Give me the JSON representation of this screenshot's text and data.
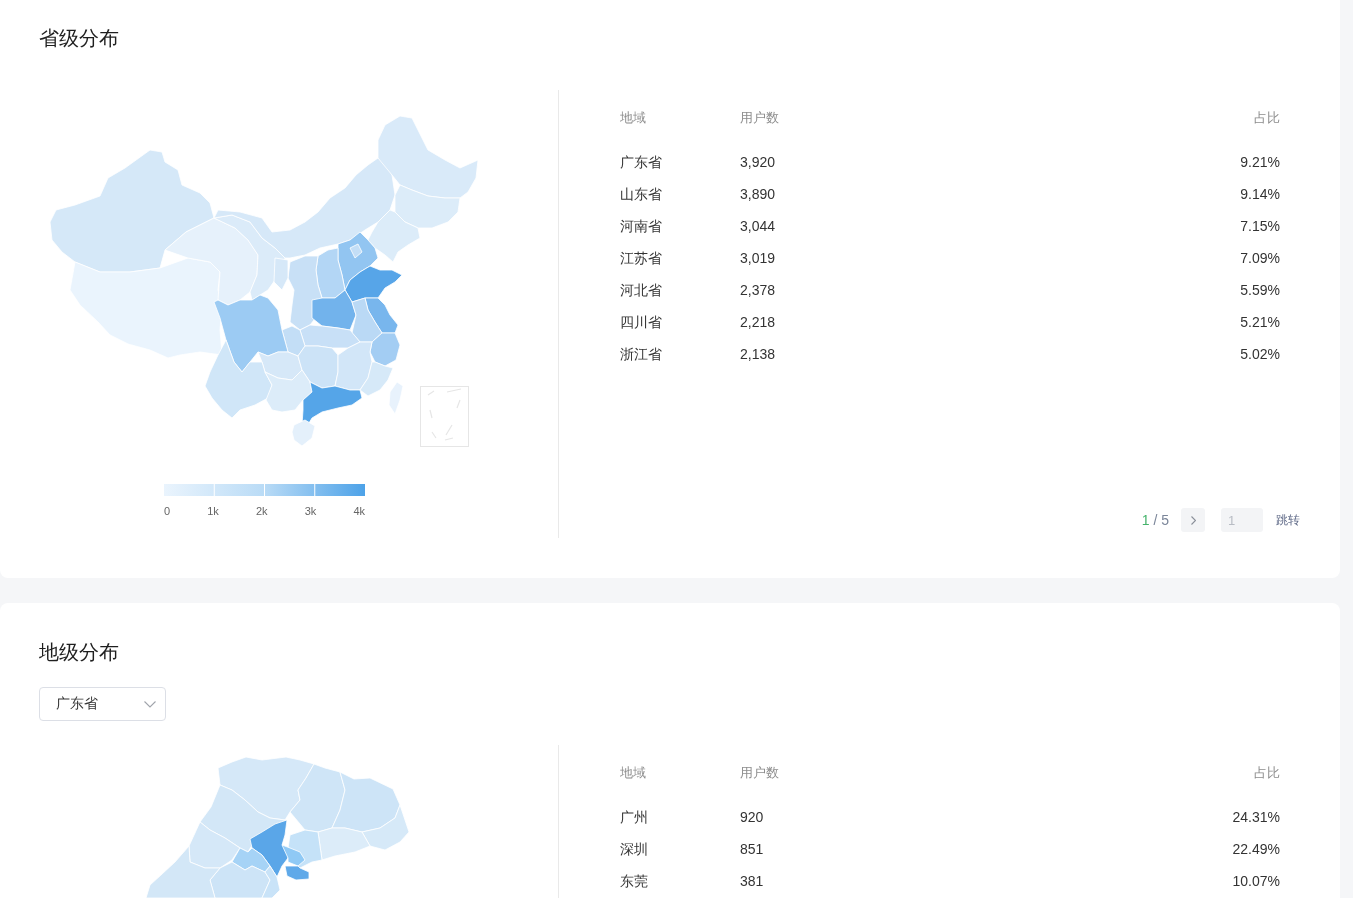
{
  "province_distribution": {
    "title": "省级分布",
    "legend": {
      "labels": [
        "0",
        "1k",
        "2k",
        "3k",
        "4k"
      ]
    },
    "table": {
      "columns": [
        "地域",
        "用户数",
        "占比"
      ],
      "rows": [
        {
          "region": "广东省",
          "users": "3,920",
          "share": "9.21%"
        },
        {
          "region": "山东省",
          "users": "3,890",
          "share": "9.14%"
        },
        {
          "region": "河南省",
          "users": "3,044",
          "share": "7.15%"
        },
        {
          "region": "江苏省",
          "users": "3,019",
          "share": "7.09%"
        },
        {
          "region": "河北省",
          "users": "2,378",
          "share": "5.59%"
        },
        {
          "region": "四川省",
          "users": "2,218",
          "share": "5.21%"
        },
        {
          "region": "浙江省",
          "users": "2,138",
          "share": "5.02%"
        }
      ]
    },
    "pagination": {
      "current": "1",
      "total": "/ 5",
      "jump_placeholder": "1",
      "jump_label": "跳转"
    }
  },
  "city_distribution": {
    "title": "地级分布",
    "select": {
      "value": "广东省"
    },
    "table": {
      "columns": [
        "地域",
        "用户数",
        "占比"
      ],
      "rows": [
        {
          "region": "广州",
          "users": "920",
          "share": "24.31%"
        },
        {
          "region": "深圳",
          "users": "851",
          "share": "22.49%"
        },
        {
          "region": "东莞",
          "users": "381",
          "share": "10.07%"
        }
      ]
    }
  }
}
